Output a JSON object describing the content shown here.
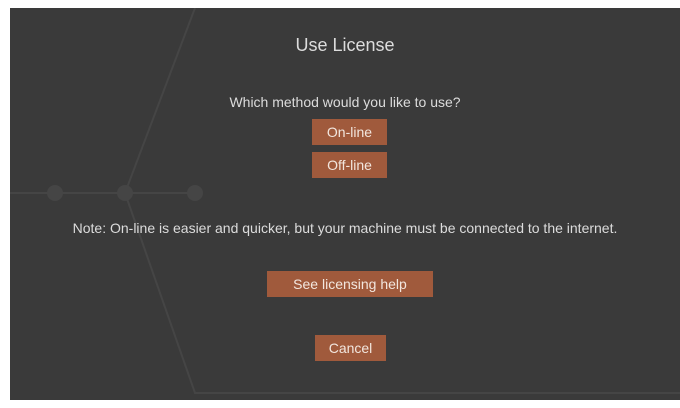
{
  "dialog": {
    "title": "Use License",
    "question": "Which method would you like to use?",
    "online_label": "On-line",
    "offline_label": "Off-line",
    "note": "Note: On-line is easier and quicker, but your machine must be connected to the internet.",
    "help_label": "See licensing help",
    "cancel_label": "Cancel"
  },
  "colors": {
    "background": "#3a3a3a",
    "button": "#a05a3c",
    "text": "#dcdcdc"
  }
}
